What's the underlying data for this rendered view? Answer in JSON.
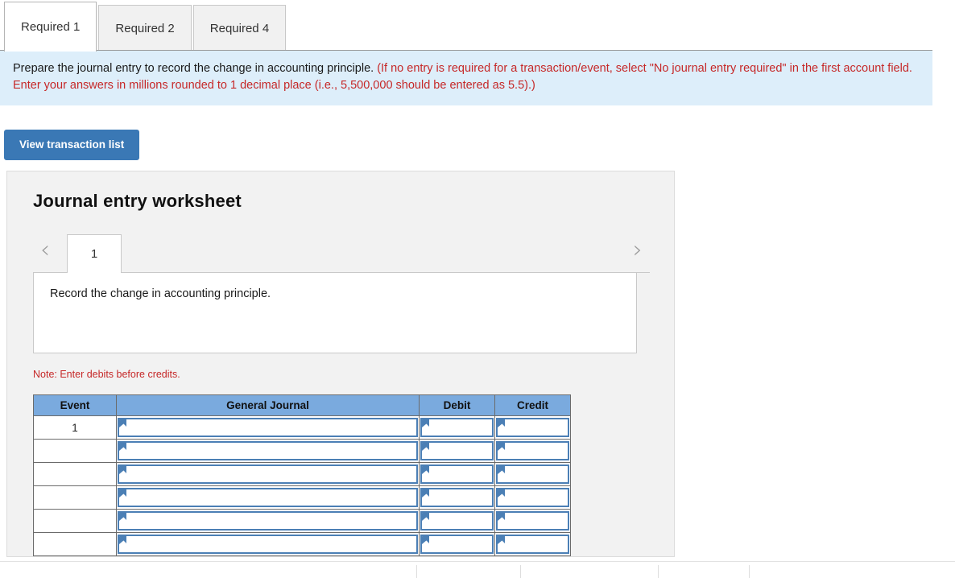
{
  "tabs": [
    {
      "label": "Required 1",
      "active": true
    },
    {
      "label": "Required 2",
      "active": false
    },
    {
      "label": "Required 4",
      "active": false
    }
  ],
  "instructions": {
    "main": "Prepare the journal entry to record the change in accounting principle.",
    "hint": "(If no entry is required for a transaction/event, select \"No journal entry required\" in the first account field. Enter your answers in millions rounded to 1 decimal place (i.e., 5,500,000 should be entered as 5.5).)"
  },
  "toolbar": {
    "view_transaction_list_label": "View transaction list"
  },
  "worksheet": {
    "title": "Journal entry worksheet",
    "pager": {
      "prev_icon": "chevron-left-icon",
      "next_icon": "chevron-right-icon",
      "current_page": "1"
    },
    "description": "Record the change in accounting principle.",
    "note": "Note: Enter debits before credits.",
    "table": {
      "headers": [
        "Event",
        "General Journal",
        "Debit",
        "Credit"
      ],
      "rows": [
        {
          "event": "1",
          "general_journal": "",
          "debit": "",
          "credit": ""
        },
        {
          "event": "",
          "general_journal": "",
          "debit": "",
          "credit": ""
        },
        {
          "event": "",
          "general_journal": "",
          "debit": "",
          "credit": ""
        },
        {
          "event": "",
          "general_journal": "",
          "debit": "",
          "credit": ""
        },
        {
          "event": "",
          "general_journal": "",
          "debit": "",
          "credit": ""
        },
        {
          "event": "",
          "general_journal": "",
          "debit": "",
          "credit": ""
        }
      ]
    }
  },
  "colors": {
    "accent_blue": "#3a78b5",
    "table_header_blue": "#7aaade",
    "info_background": "#ddeefa",
    "hint_red": "#c62828",
    "panel_background": "#f2f2f2"
  }
}
